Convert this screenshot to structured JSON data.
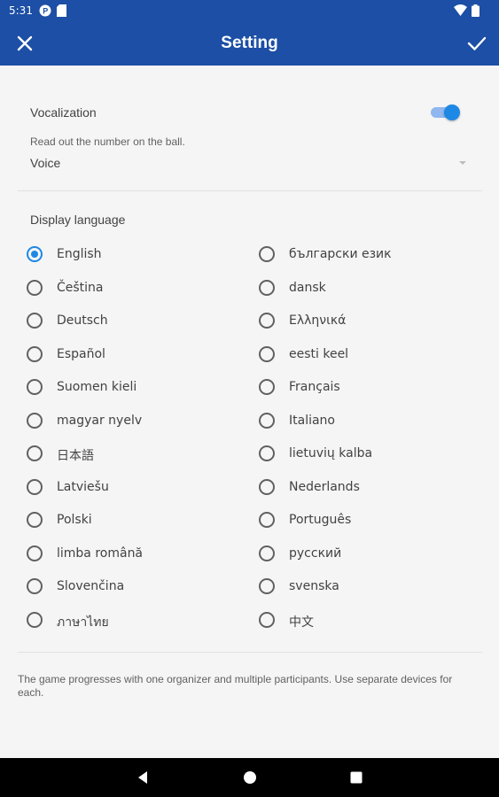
{
  "status_bar": {
    "time": "5:31",
    "icons": [
      "circle-p-icon",
      "sd-card-icon",
      "wifi-icon",
      "battery-icon"
    ]
  },
  "app_bar": {
    "title": "Setting",
    "close_icon": "close-icon",
    "confirm_icon": "check-icon",
    "color": "#1c4fa5"
  },
  "vocalization": {
    "label": "Vocalization",
    "enabled": true,
    "description": "Read out the number on the ball.",
    "voice_value": "Voice"
  },
  "language": {
    "title": "Display language",
    "selected": "English",
    "left_options": [
      "English",
      "Čeština",
      "Deutsch",
      "Español",
      "Suomen kieli",
      "magyar nyelv",
      "日本語",
      "Latviešu",
      "Polski",
      "limba română",
      "Slovenčina",
      "ภาษาไทย"
    ],
    "right_options": [
      "български език",
      "dansk",
      "Ελληνικά",
      "eesti keel",
      "Français",
      "Italiano",
      "lietuvių kalba",
      "Nederlands",
      "Português",
      "русский",
      "svenska",
      "中文"
    ]
  },
  "footer": {
    "note": "The game progresses with one organizer and multiple participants. Use separate devices for each."
  },
  "nav_bar": {
    "icons": [
      "back-icon",
      "home-icon",
      "recents-icon"
    ]
  },
  "colors": {
    "accent": "#1e88e5",
    "app_bar": "#1c4fa5"
  }
}
